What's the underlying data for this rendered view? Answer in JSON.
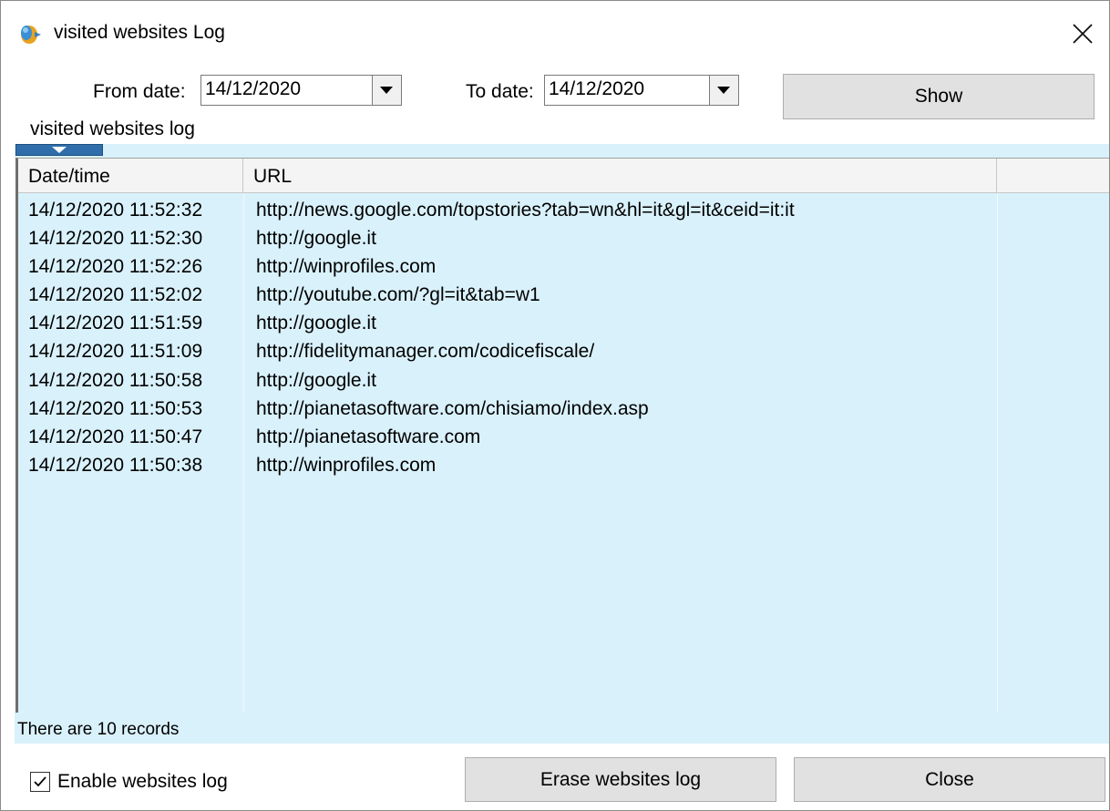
{
  "window": {
    "title": "visited websites Log",
    "app_icon": "app-icon",
    "close_icon": "close-icon"
  },
  "filters": {
    "from_label": "From date:",
    "from_value": "14/12/2020",
    "to_label": "To date:",
    "to_value": "14/12/2020",
    "show_label": "Show"
  },
  "section_label": "visited websites log",
  "grid": {
    "columns": [
      "Date/time",
      "URL",
      ""
    ],
    "rows": [
      {
        "datetime": "14/12/2020 11:52:32",
        "url": "http://news.google.com/topstories?tab=wn&hl=it&gl=it&ceid=it:it"
      },
      {
        "datetime": "14/12/2020 11:52:30",
        "url": "http://google.it"
      },
      {
        "datetime": "14/12/2020 11:52:26",
        "url": "http://winprofiles.com"
      },
      {
        "datetime": "14/12/2020 11:52:02",
        "url": "http://youtube.com/?gl=it&tab=w1"
      },
      {
        "datetime": "14/12/2020 11:51:59",
        "url": "http://google.it"
      },
      {
        "datetime": "14/12/2020 11:51:09",
        "url": "http://fidelitymanager.com/codicefiscale/"
      },
      {
        "datetime": "14/12/2020 11:50:58",
        "url": "http://google.it"
      },
      {
        "datetime": "14/12/2020 11:50:53",
        "url": "http://pianetasoftware.com/chisiamo/index.asp"
      },
      {
        "datetime": "14/12/2020 11:50:47",
        "url": "http://pianetasoftware.com"
      },
      {
        "datetime": "14/12/2020 11:50:38",
        "url": "http://winprofiles.com"
      }
    ]
  },
  "status_text": "There are 10 records",
  "footer": {
    "enable_log_label": "Enable websites log",
    "enable_log_checked": true,
    "erase_label": "Erase websites log",
    "close_label": "Close"
  },
  "colors": {
    "grid_background": "#d9f1fb",
    "splitter_tab": "#2f6eaa",
    "button_face": "#e1e1e1"
  }
}
